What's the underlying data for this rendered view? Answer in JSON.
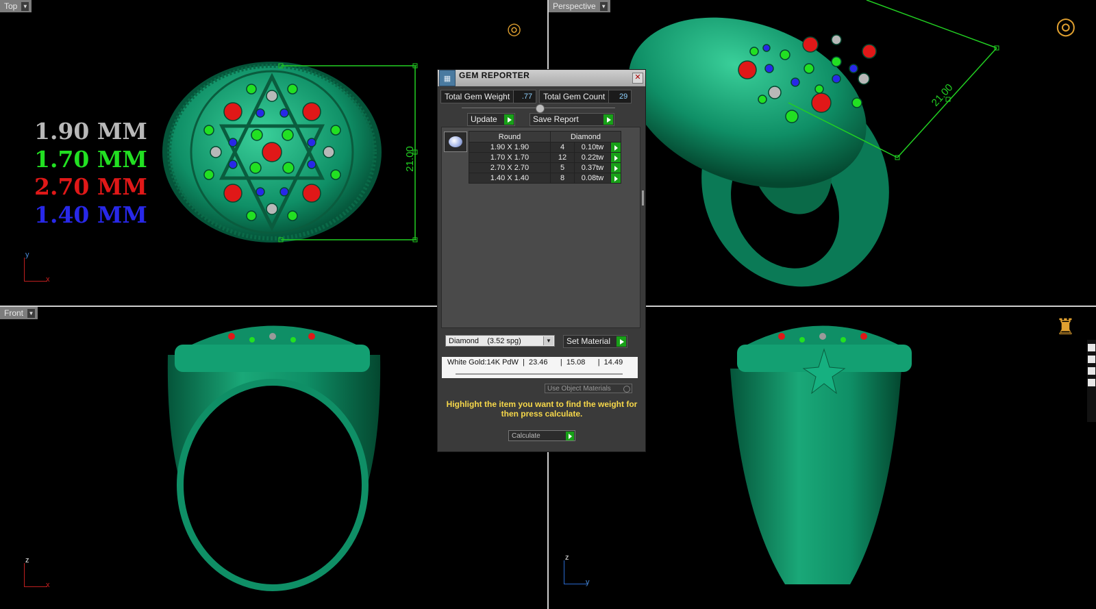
{
  "viewports": {
    "top": {
      "label": "Top",
      "axis": {
        "v": "y",
        "h": "x"
      },
      "dimension": "21.00"
    },
    "perspective": {
      "label": "Perspective",
      "dimension": "21.00"
    },
    "front": {
      "label": "Front",
      "axis": {
        "v": "z",
        "h": "x"
      }
    },
    "right": {
      "axis": {
        "v": "z",
        "h": "y"
      }
    }
  },
  "mm_legend": [
    {
      "text": "1.90 MM",
      "color": "#b8b8b8"
    },
    {
      "text": "1.70 MM",
      "color": "#22e022"
    },
    {
      "text": "2.70 MM",
      "color": "#e01818"
    },
    {
      "text": "1.40 MM",
      "color": "#2828e8"
    }
  ],
  "colors": {
    "ring": "#0f8f66",
    "ring_dark": "#05553a",
    "ring_light": "#3ad09a",
    "dim_line": "#22d022",
    "accent_go": "#18a018",
    "hint": "#f7d84a"
  },
  "gem_reporter": {
    "title": "GEM REPORTER",
    "total_gem_weight_label": "Total Gem Weight",
    "total_gem_weight": ".77",
    "total_gem_count_label": "Total Gem Count",
    "total_gem_count": "29",
    "update_label": "Update",
    "save_report_label": "Save Report",
    "table": {
      "headers": [
        "Round",
        "Diamond"
      ],
      "rows": [
        {
          "size": "1.90 X 1.90",
          "count": "4",
          "weight": "0.10tw"
        },
        {
          "size": "1.70 X 1.70",
          "count": "12",
          "weight": "0.22tw"
        },
        {
          "size": "2.70 X 2.70",
          "count": "5",
          "weight": "0.37tw"
        },
        {
          "size": "1.40 X 1.40",
          "count": "8",
          "weight": "0.08tw"
        }
      ]
    },
    "material_select": "Diamond    (3.52 spg)",
    "set_material_label": "Set Material",
    "metal_row": "White Gold:14K PdW  |  23.46      |  15.08      |  14.49",
    "use_object_materials": "Use Object Materials",
    "hint": "Highlight the item you want to find the weight for then press calculate.",
    "calculate_label": "Calculate"
  }
}
